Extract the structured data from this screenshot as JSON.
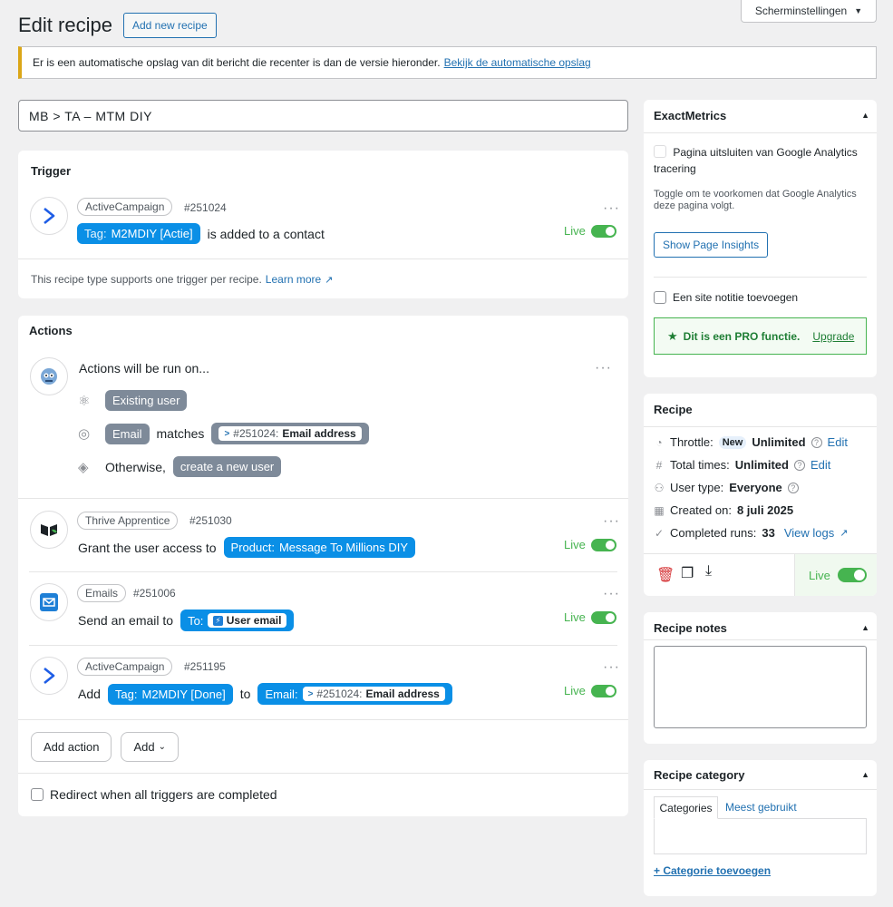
{
  "screen_options": {
    "label": "Scherminstellingen"
  },
  "header": {
    "title": "Edit recipe",
    "add_new": "Add new recipe"
  },
  "notice": {
    "text": "Er is een automatische opslag van dit bericht die recenter is dan de versie hieronder.",
    "link": "Bekijk de automatische opslag"
  },
  "recipe_title": "MB > TA – MTM DIY",
  "trigger": {
    "heading": "Trigger",
    "integration": "ActiveCampaign",
    "id": "#251024",
    "tag_label": "Tag:",
    "tag_value": "M2MDIY [Actie]",
    "sentence_end": "is added to a contact",
    "status": "Live",
    "footer_text": "This recipe type supports one trigger per recipe.",
    "footer_link": "Learn more"
  },
  "actions": {
    "heading": "Actions",
    "run_on": "Actions will be run on...",
    "existing_user": "Existing user",
    "email_token": "Email",
    "matches": "matches",
    "match_id": "#251024:",
    "match_field": "Email address",
    "otherwise": "Otherwise,",
    "create_user": "create a new user",
    "items": [
      {
        "integration": "Thrive Apprentice",
        "id": "#251030",
        "prefix": "Grant the user access to",
        "token_label": "Product:",
        "token_value": "Message To Millions DIY",
        "status": "Live"
      },
      {
        "integration": "Emails",
        "id": "#251006",
        "prefix": "Send an email to",
        "token_label": "To:",
        "token_value": "User email",
        "status": "Live"
      },
      {
        "integration": "ActiveCampaign",
        "id": "#251195",
        "prefix": "Add",
        "token_label": "Tag:",
        "token_value": "M2MDIY [Done]",
        "middle": "to",
        "email_label": "Email:",
        "email_id": "#251024:",
        "email_field": "Email address",
        "status": "Live"
      }
    ],
    "add_action": "Add action",
    "add": "Add",
    "redirect": "Redirect when all triggers are completed"
  },
  "exactmetrics": {
    "title": "ExactMetrics",
    "exclude": "Pagina uitsluiten van Google Analytics tracering",
    "help": "Toggle om te voorkomen dat Google Analytics deze pagina volgt.",
    "insights": "Show Page Insights",
    "site_note": "Een site notitie toevoegen",
    "pro_text": "Dit is een PRO functie.",
    "upgrade": "Upgrade"
  },
  "recipe_box": {
    "title": "Recipe",
    "throttle_label": "Throttle:",
    "throttle_badge": "New",
    "throttle_value": "Unlimited",
    "total_label": "Total times:",
    "total_value": "Unlimited",
    "edit": "Edit",
    "user_type_label": "User type:",
    "user_type_value": "Everyone",
    "created_label": "Created on:",
    "created_value": "8 juli 2025",
    "runs_label": "Completed runs:",
    "runs_value": "33",
    "view_logs": "View logs",
    "status": "Live"
  },
  "notes": {
    "title": "Recipe notes"
  },
  "category": {
    "title": "Recipe category",
    "tab_all": "Categories",
    "tab_used": "Meest gebruikt",
    "add": "+ Categorie toevoegen"
  },
  "colors": {
    "accent": "#2271b1",
    "token_blue": "#0a8fe6",
    "token_gray": "#7e8a99",
    "live_green": "#46b450",
    "warning": "#dba617"
  }
}
